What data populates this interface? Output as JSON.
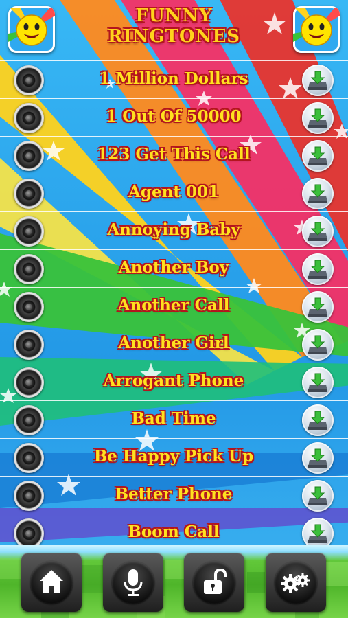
{
  "header": {
    "title_line1": "FUNNY",
    "title_line2": "RINGTONES",
    "left_icon": "smiley-face-icon",
    "right_icon": "smiley-face-icon"
  },
  "ringtones": [
    {
      "label": "1 Million Dollars"
    },
    {
      "label": "1 Out Of 50000"
    },
    {
      "label": "123 Get This Call"
    },
    {
      "label": "Agent 001"
    },
    {
      "label": "Annoying Baby"
    },
    {
      "label": "Another Boy"
    },
    {
      "label": "Another Call"
    },
    {
      "label": "Another Girl"
    },
    {
      "label": "Arrogant Phone"
    },
    {
      "label": "Bad Time"
    },
    {
      "label": "Be Happy Pick Up"
    },
    {
      "label": "Better Phone"
    },
    {
      "label": "Boom Call"
    }
  ],
  "row_icons": {
    "play": "speaker-icon",
    "download": "download-icon"
  },
  "bottom_nav": [
    {
      "icon": "home-icon"
    },
    {
      "icon": "microphone-icon"
    },
    {
      "icon": "unlock-icon"
    },
    {
      "icon": "settings-gears-icon"
    }
  ],
  "colors": {
    "title_fill": "#ffd21c",
    "title_outline": "#b3151e",
    "sky_blue": "#2fa9f0",
    "button_dark": "#1f1f1f"
  }
}
